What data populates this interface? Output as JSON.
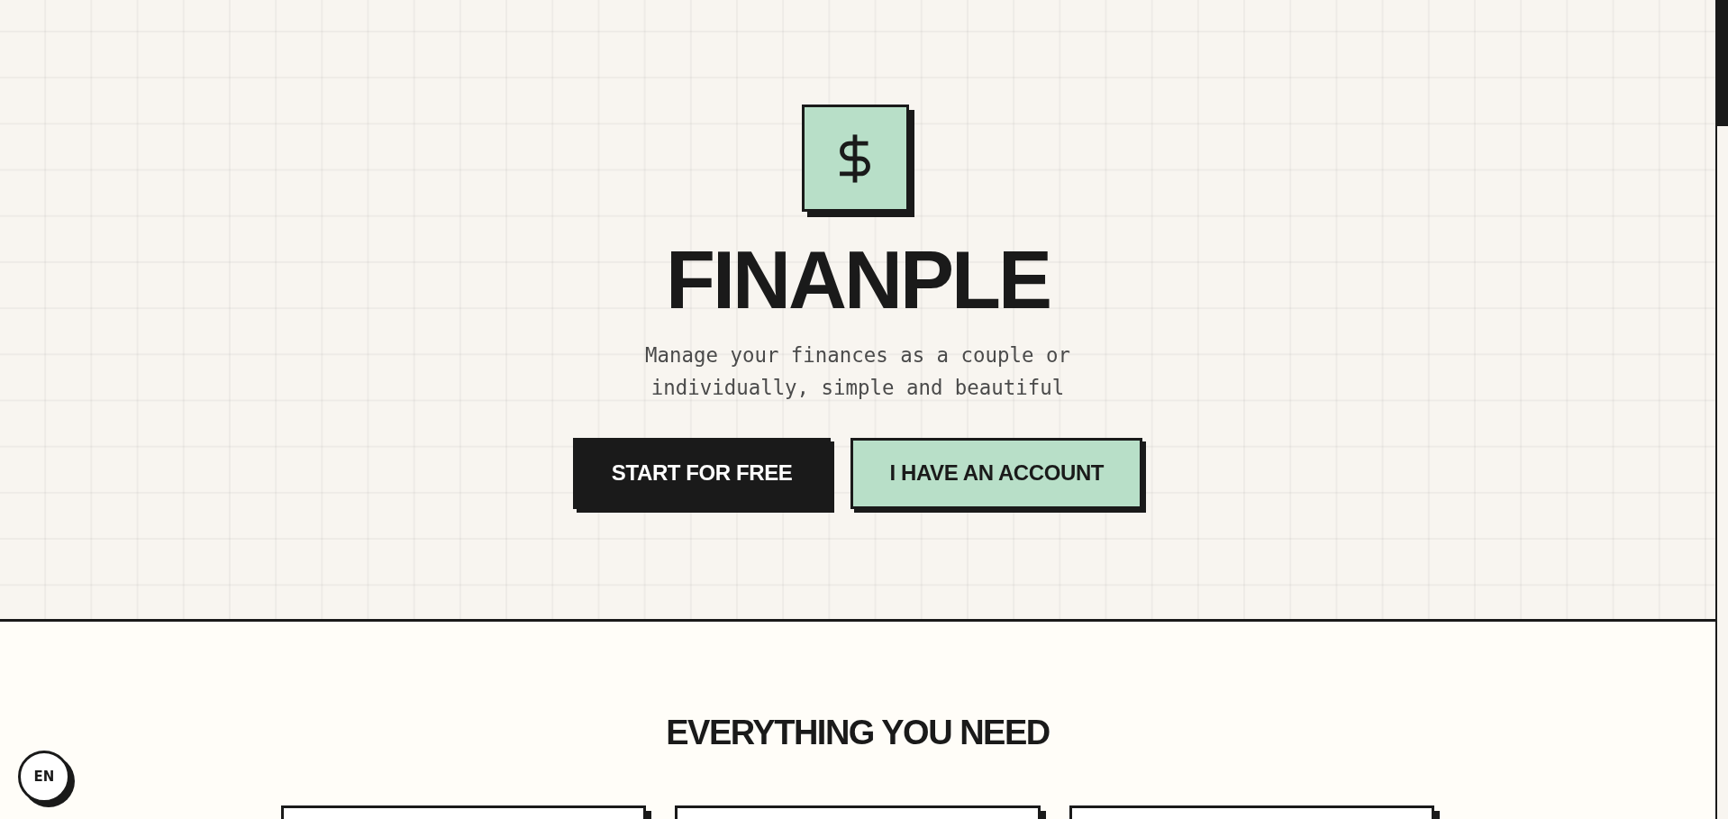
{
  "hero": {
    "title": "FINANPLE",
    "subtitle": "Manage your finances as a couple or individually, simple and beautiful",
    "buttons": [
      {
        "label": "START FOR FREE",
        "kind": "primary"
      },
      {
        "label": "I HAVE AN ACCOUNT",
        "kind": "secondary"
      }
    ]
  },
  "features": {
    "heading": "EVERYTHING YOU NEED"
  },
  "language_button": {
    "label": "EN"
  }
}
